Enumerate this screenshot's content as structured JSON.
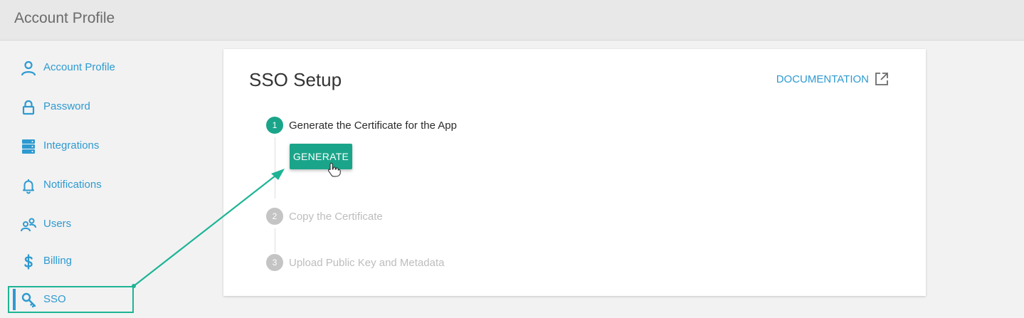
{
  "header": {
    "title": "Account Profile"
  },
  "sidebar": {
    "items": [
      {
        "label": "Account Profile",
        "icon": "user-icon"
      },
      {
        "label": "Password",
        "icon": "lock-icon"
      },
      {
        "label": "Integrations",
        "icon": "server-icon"
      },
      {
        "label": "Notifications",
        "icon": "bell-icon"
      },
      {
        "label": "Users",
        "icon": "users-icon"
      },
      {
        "label": "Billing",
        "icon": "dollar-icon"
      },
      {
        "label": "SSO",
        "icon": "key-icon",
        "active": true
      }
    ]
  },
  "card": {
    "title": "SSO Setup",
    "doc_link": "DOCUMENTATION",
    "steps": [
      {
        "number": "1",
        "label": "Generate the Certificate for the App",
        "active": true
      },
      {
        "number": "2",
        "label": "Copy the Certificate",
        "active": false
      },
      {
        "number": "3",
        "label": "Upload Public Key and Metadata",
        "active": false
      }
    ],
    "generate_button": "GENERATE"
  },
  "colors": {
    "accent": "#2e9ad0",
    "primary": "#1aa58a",
    "highlight": "#1db495",
    "inactive": "#c4c4c4"
  }
}
